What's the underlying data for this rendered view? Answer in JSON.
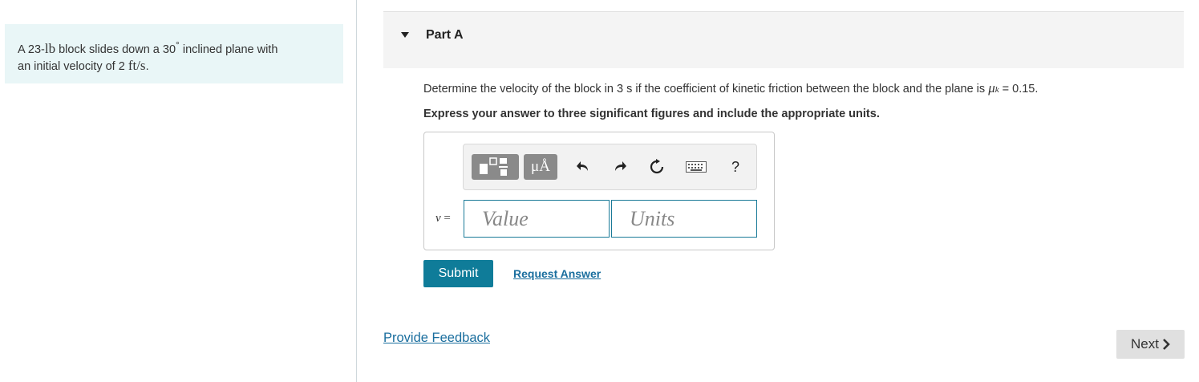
{
  "problem": {
    "text_1": "A 23-",
    "unit_lb": "lb",
    "text_2": " block slides down a 30",
    "degree": "°",
    "text_3": " inclined plane with",
    "text_4": "an initial velocity of 2 ",
    "unit_ftps": "ft/s",
    "text_5": "."
  },
  "part": {
    "title": "Part A"
  },
  "question": {
    "text": "Determine the velocity of the block in 3 s if the coefficient of kinetic friction between the block and the plane is ",
    "mu_symbol": "μ",
    "mu_subscript": "k",
    "value": " = 0.15.",
    "instruction": "Express your answer to three significant figures and include the appropriate units."
  },
  "toolbar": {
    "template_icon": "fraction-template-icon",
    "units_label": "μÅ",
    "undo_icon": "undo-icon",
    "redo_icon": "redo-icon",
    "reset_icon": "reset-icon",
    "keyboard_icon": "keyboard-icon",
    "help_label": "?"
  },
  "answer": {
    "variable": "v",
    "equals": " =",
    "value_placeholder": "Value",
    "units_placeholder": "Units"
  },
  "actions": {
    "submit_label": "Submit",
    "request_label": "Request Answer",
    "feedback_label": "Provide Feedback",
    "next_label": "Next",
    "next_icon": "chevron-right-icon"
  },
  "colors": {
    "accent": "#0f7c99",
    "link": "#1a6e9e",
    "problem_bg": "#e9f6f7"
  }
}
